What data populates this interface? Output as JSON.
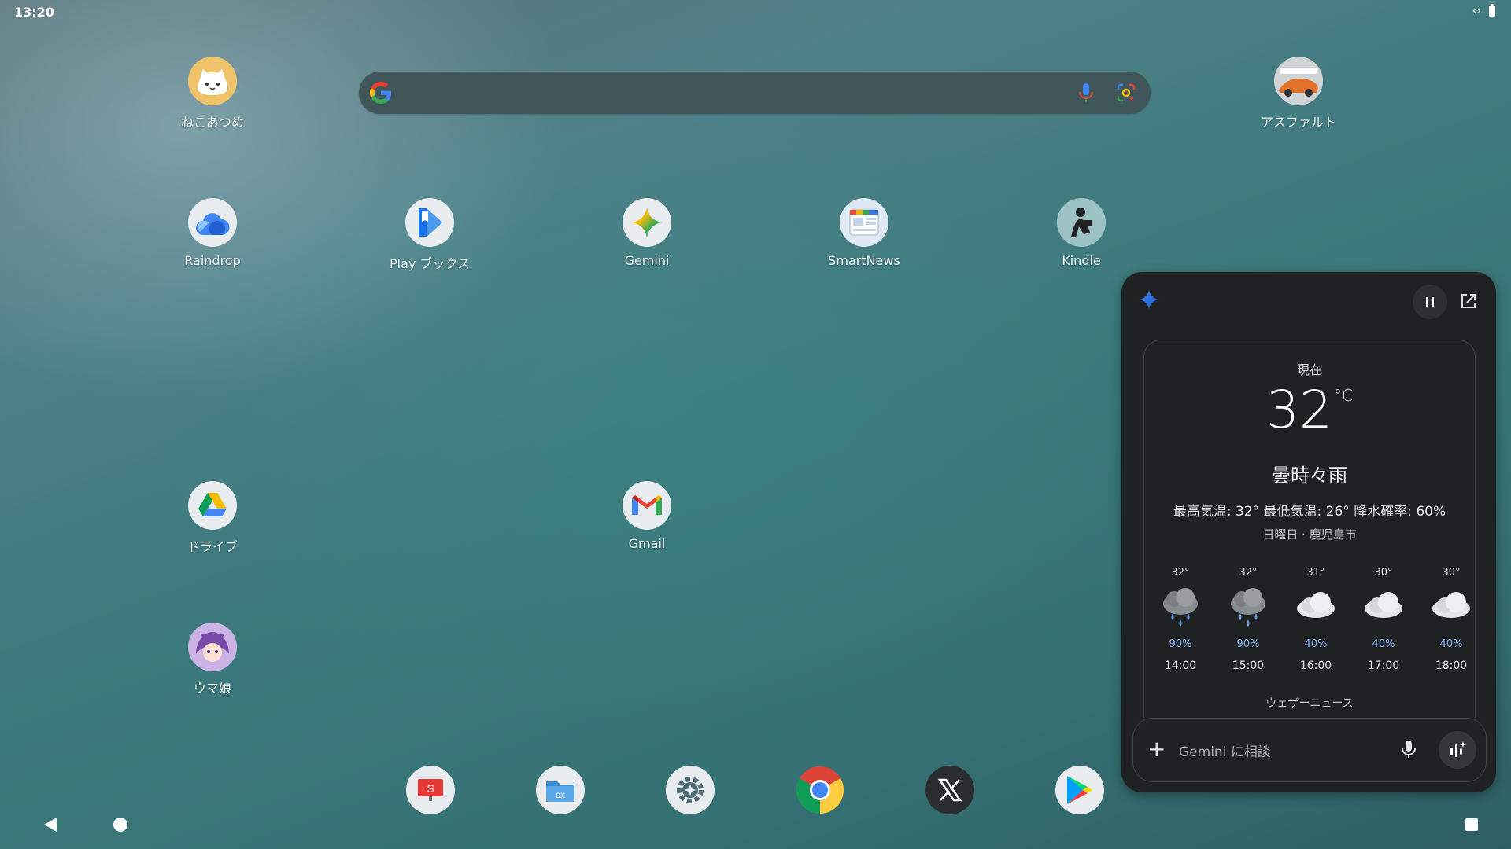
{
  "status_bar": {
    "time": "13:20",
    "extra_icon": "‹›"
  },
  "search": {
    "placeholder": ""
  },
  "apps": [
    {
      "id": "neko",
      "label": "ねこあつめ"
    },
    {
      "id": "asphalt",
      "label": "アスファルト"
    },
    {
      "id": "raindrop",
      "label": "Raindrop"
    },
    {
      "id": "playbooks",
      "label": "Play ブックス"
    },
    {
      "id": "gemini",
      "label": "Gemini"
    },
    {
      "id": "smartnews",
      "label": "SmartNews"
    },
    {
      "id": "kindle",
      "label": "Kindle"
    },
    {
      "id": "drive",
      "label": "ドライブ"
    },
    {
      "id": "gmail",
      "label": "Gmail"
    },
    {
      "id": "umamusume",
      "label": "ウマ娘"
    }
  ],
  "dock": {
    "presentation_badge": "S",
    "filemanager_badge": "cx"
  },
  "gemini_panel": {
    "weather": {
      "now_label": "現在",
      "temperature": "32",
      "unit": "°C",
      "condition": "曇時々雨",
      "details": "最高気温: 32° 最低気温: 26° 降水確率: 60%",
      "location": "日曜日 · 鹿児島市",
      "hourly": [
        {
          "temp": "32°",
          "icon": "rain-cloud-icon",
          "precip": "90%",
          "time": "14:00"
        },
        {
          "temp": "32°",
          "icon": "rain-cloud-icon",
          "precip": "90%",
          "time": "15:00"
        },
        {
          "temp": "31°",
          "icon": "cloud-icon",
          "precip": "40%",
          "time": "16:00"
        },
        {
          "temp": "30°",
          "icon": "cloud-icon",
          "precip": "40%",
          "time": "17:00"
        },
        {
          "temp": "30°",
          "icon": "cloud-icon",
          "precip": "40%",
          "time": "18:00"
        }
      ],
      "source": "ウェザーニュース"
    },
    "input": {
      "placeholder": "Gemini に相談"
    }
  },
  "colors": {
    "panel_bg": "#1f2123",
    "precip_blue": "#8ab4f8",
    "gemini_blue": "#4285f4"
  }
}
